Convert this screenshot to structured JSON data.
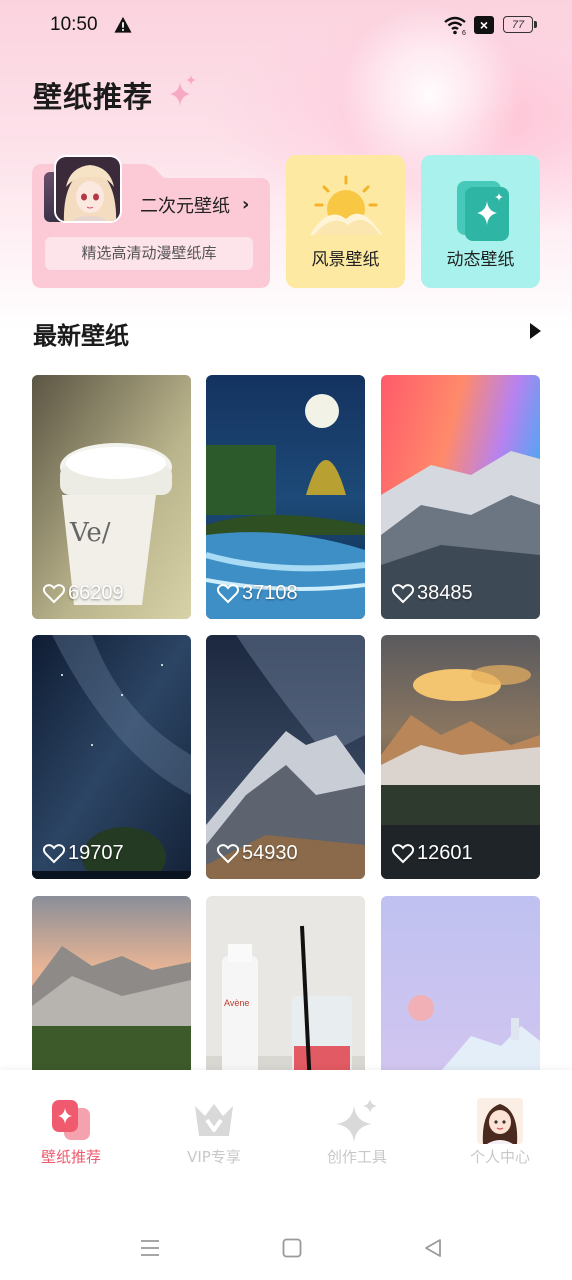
{
  "status_bar": {
    "time": "10:50",
    "battery": "77"
  },
  "header": {
    "title": "壁纸推荐"
  },
  "categories": {
    "anime": {
      "label": "二次元壁纸",
      "arrow": "›",
      "subtitle": "精选高清动漫壁纸库"
    },
    "scenery": {
      "label": "风景壁纸"
    },
    "dynamic": {
      "label": "动态壁纸"
    }
  },
  "latest": {
    "title": "最新壁纸",
    "items": [
      {
        "likes": "66209",
        "theme": "coffee-cup"
      },
      {
        "likes": "37108",
        "theme": "night-river"
      },
      {
        "likes": "38485",
        "theme": "rainbow-mountain"
      },
      {
        "likes": "19707",
        "theme": "starry-sky"
      },
      {
        "likes": "54930",
        "theme": "milky-way-peak"
      },
      {
        "likes": "12601",
        "theme": "sunset-mountain"
      },
      {
        "likes": "",
        "theme": "alpine-valley"
      },
      {
        "likes": "",
        "theme": "bottle-and-cup"
      },
      {
        "likes": "",
        "theme": "moon-iceberg"
      }
    ]
  },
  "tabs": [
    {
      "label": "壁纸推荐",
      "active": true
    },
    {
      "label": "VIP专享",
      "active": false
    },
    {
      "label": "创作工具",
      "active": false
    },
    {
      "label": "个人中心",
      "active": false
    }
  ],
  "colors": {
    "accent": "#ef5a6e",
    "scenery_card": "#fde9a2",
    "dynamic_card": "#a9f1ec",
    "anime_card": "#fcc9d6"
  }
}
